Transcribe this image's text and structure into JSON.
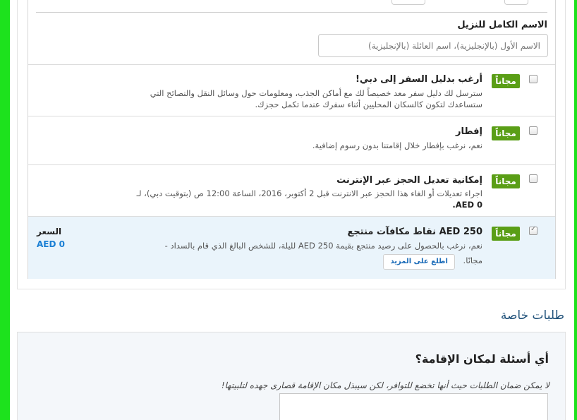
{
  "form": {
    "name_label": "الاسم الكامل للنزيل",
    "name_placeholder": "الاسم الأول (بالإنجليزية)، اسم العائلة (بالإنجليزية)"
  },
  "options": [
    {
      "badge": "مجاناً",
      "title": "أرغب بدليل السفر إلى دبي!",
      "desc_line1": "سترسل لك دليل سفر معد خصيصاً لك مع أماكن الجذب، ومعلومات حول وسائل النقل والنصائح التي",
      "desc_line2": "ستساعدك لتكون كالسكان المحليين أثناء سفرك عندما تكمل حجزك.",
      "checked": false
    },
    {
      "badge": "مجاناً",
      "title": "إفطار",
      "desc_line1": "نعم، نرغب بإفطار خلال إقامتنا بدون رسوم إضافية.",
      "checked": false
    },
    {
      "badge": "مجاناً",
      "title": "إمكانية تعديل الحجز عبر الإنترنت",
      "desc_line1": "اجراء تعديلات أو الغاء هذا الحجز عبر الانترنت قبل 2 أكتوبر، 2016، الساعة 12:00 ص (بتوقيت دبي)، لـ",
      "desc_line2": "AED 0.",
      "checked": false
    },
    {
      "badge": "مجاناً",
      "title": "250 AED نقاط مكافآت منتجع",
      "desc_line1": "نعم، نرغب بالحصول على رصيد منتجع بقيمة 250 AED لليلة، للشخص البالغ الذي قام بالسداد -",
      "desc_line2": "مجانًا.",
      "learn_more": "اطلع على المزيد",
      "price_label": "السعر",
      "price_value": "AED 0",
      "checked": true
    }
  ],
  "special_requests": {
    "heading": "طلبات خاصة",
    "question": "أي أسئلة لمكان الإقامة؟",
    "note": "لا يمكن ضمان الطلبات حيث أنها تخضع للتوافر، لكن سيبذل مكان الإقامة قصارى جهده لتلبيتها!"
  },
  "colors": {
    "free_badge": "#5a9e16",
    "price": "#1a7fd4",
    "heading": "#1d4f78",
    "frame": "#1de21d"
  }
}
